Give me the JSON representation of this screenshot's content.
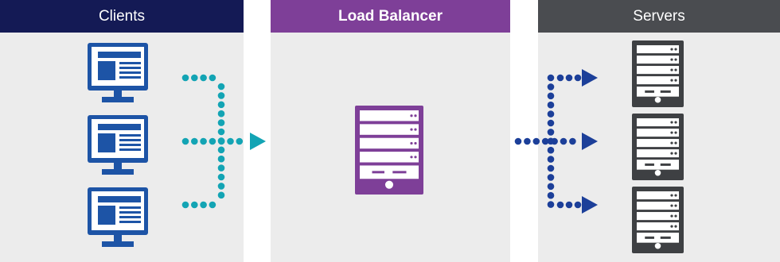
{
  "panels": {
    "clients": {
      "title": "Clients",
      "color": "#141a55"
    },
    "load_balancer": {
      "title": "Load Balancer",
      "color": "#7e3f98"
    },
    "servers": {
      "title": "Servers",
      "color": "#4a4c50"
    }
  },
  "colors": {
    "panel_bg": "#ececec",
    "monitor": "#1d54a6",
    "client_dots": "#13a4b4",
    "server_dots": "#1c3f99",
    "lb_server": "#7e3f98",
    "server": "#3e4043"
  },
  "icons": {
    "client": "monitor-icon",
    "load_balancer": "server-icon",
    "server": "server-icon"
  }
}
